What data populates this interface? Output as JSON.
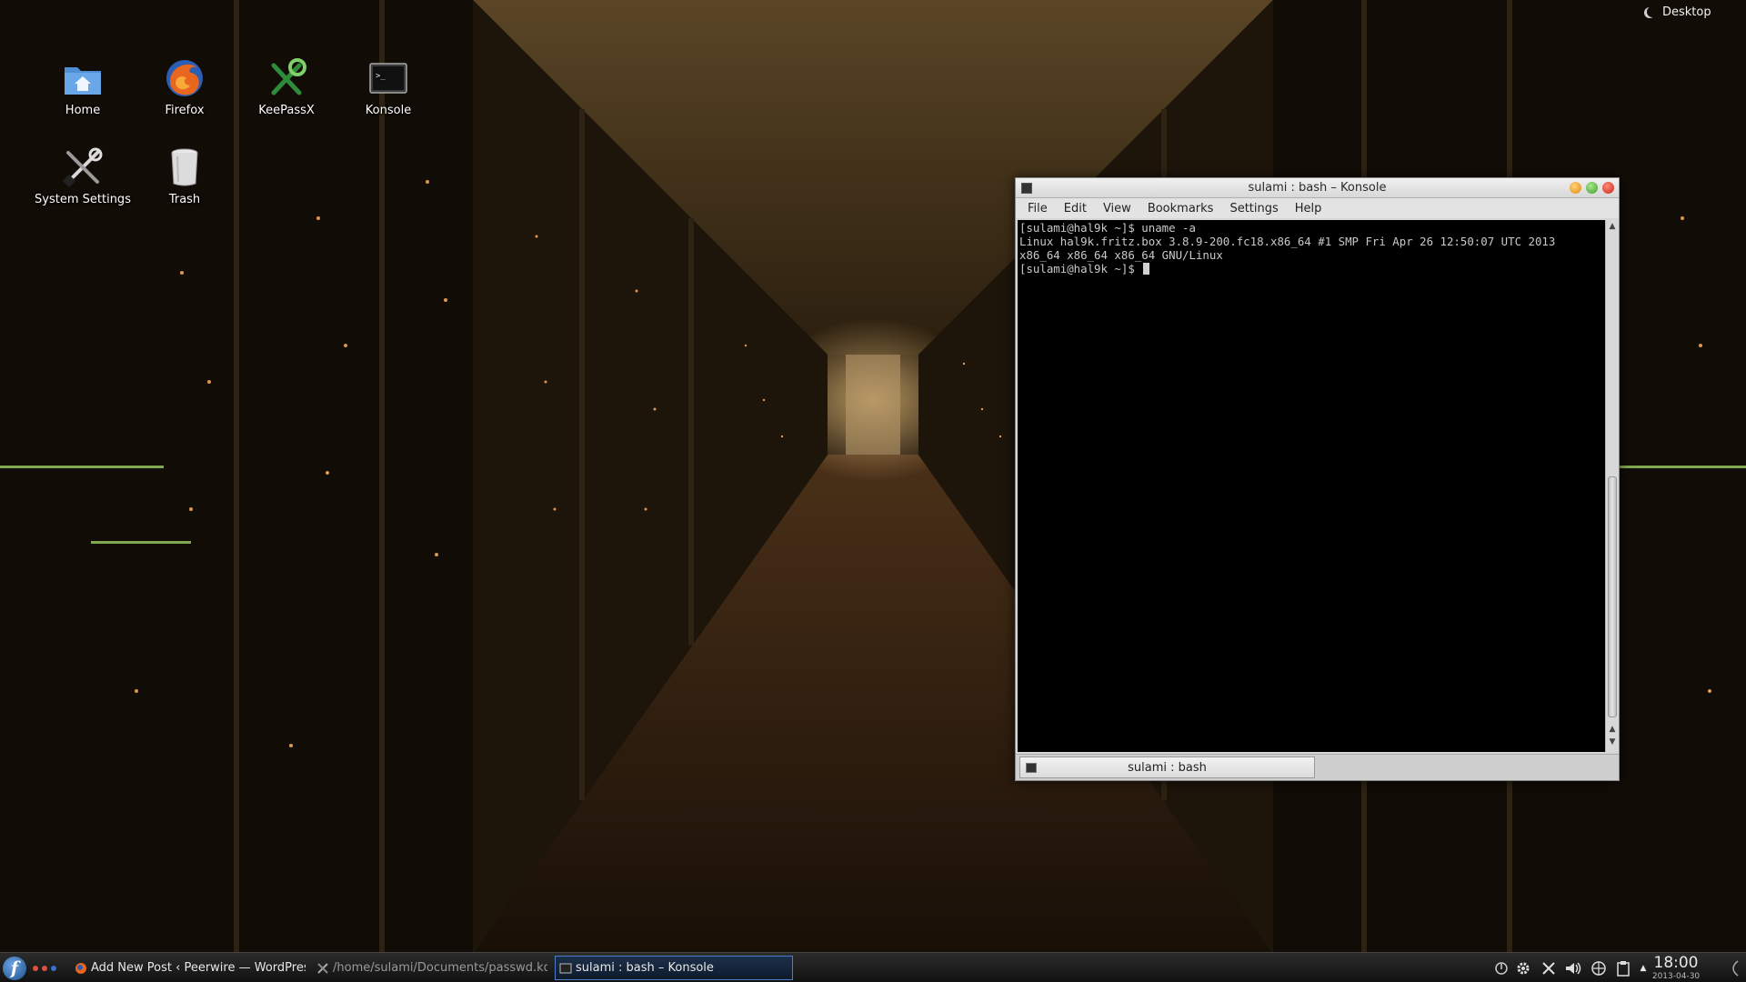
{
  "desktop": {
    "activity_label": "Desktop",
    "icons": [
      {
        "label": "Home"
      },
      {
        "label": "Firefox"
      },
      {
        "label": "KeePassX"
      },
      {
        "label": "Konsole"
      },
      {
        "label": "System Settings"
      },
      {
        "label": "Trash"
      }
    ]
  },
  "konsole": {
    "title": "sulami : bash – Konsole",
    "menu": [
      "File",
      "Edit",
      "View",
      "Bookmarks",
      "Settings",
      "Help"
    ],
    "terminal_lines": [
      "[sulami@hal9k ~]$ uname -a",
      "Linux hal9k.fritz.box 3.8.9-200.fc18.x86_64 #1 SMP Fri Apr 26 12:50:07 UTC 2013",
      "x86_64 x86_64 x86_64 GNU/Linux",
      "[sulami@hal9k ~]$ "
    ],
    "tab_label": "sulami : bash",
    "button_colors": {
      "minimize": "#f0a030",
      "maximize": "#60b040",
      "close": "#e03a2a"
    }
  },
  "taskbar": {
    "tasks": [
      {
        "label": "Add New Post ‹ Peerwire — WordPress",
        "icon": "firefox-icon"
      },
      {
        "label": "/home/sulami/Documents/passwd.kdb",
        "icon": "keepassx-icon"
      },
      {
        "label": "sulami : bash – Konsole",
        "icon": "konsole-icon",
        "active": true
      }
    ],
    "tray_icons": [
      "updates-icon",
      "settings-icon",
      "keepassx-tray-icon",
      "volume-icon",
      "network-icon",
      "clipboard-icon",
      "expand-arrow-icon"
    ],
    "clock": {
      "time": "18:00",
      "date": "2013-04-30"
    }
  }
}
